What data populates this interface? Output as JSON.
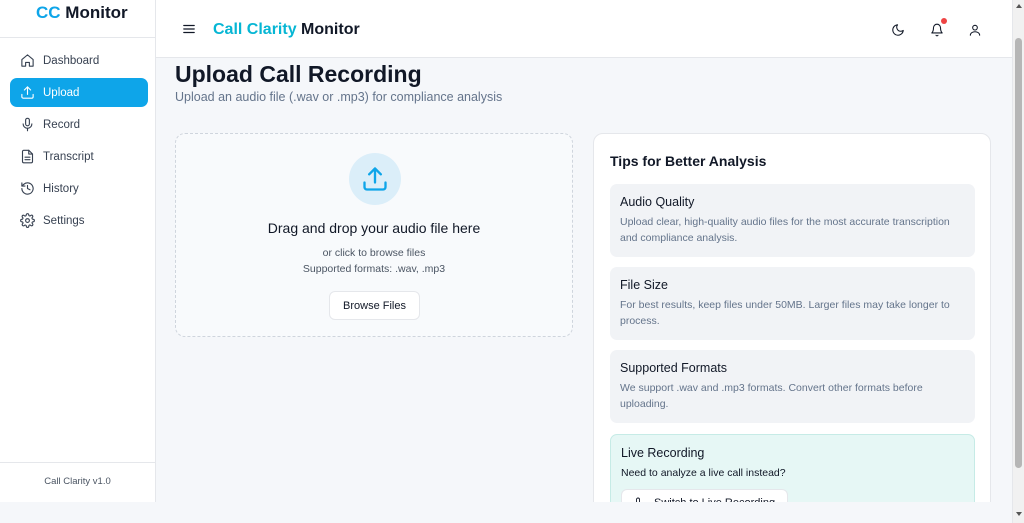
{
  "sidebar": {
    "brand_accent": "CC",
    "brand_rest": " Monitor",
    "items": [
      {
        "label": "Dashboard",
        "icon": "home-icon"
      },
      {
        "label": "Upload",
        "icon": "upload-icon",
        "active": true
      },
      {
        "label": "Record",
        "icon": "microphone-icon"
      },
      {
        "label": "Transcript",
        "icon": "file-text-icon"
      },
      {
        "label": "History",
        "icon": "history-icon"
      },
      {
        "label": "Settings",
        "icon": "gear-icon"
      }
    ],
    "footer": "Call Clarity v1.0"
  },
  "header": {
    "title_accent": "Call Clarity",
    "title_rest": " Monitor",
    "icons": [
      "menu-icon",
      "moon-icon",
      "bell-icon",
      "user-icon"
    ]
  },
  "page": {
    "title": "Upload Call Recording",
    "subtitle": "Upload an audio file (.wav or .mp3) for compliance analysis"
  },
  "dropzone": {
    "title": "Drag and drop your audio file here",
    "hint": "or click to browse files",
    "formats": "Supported formats: .wav, .mp3",
    "button": "Browse Files"
  },
  "tips": {
    "title": "Tips for Better Analysis",
    "items": [
      {
        "title": "Audio Quality",
        "text": "Upload clear, high-quality audio files for the most accurate transcription and compliance analysis."
      },
      {
        "title": "File Size",
        "text": "For best results, keep files under 50MB. Larger files may take longer to process."
      },
      {
        "title": "Supported Formats",
        "text": "We support .wav and .mp3 formats. Convert other formats before uploading."
      }
    ],
    "live": {
      "title": "Live Recording",
      "text": "Need to analyze a live call instead?",
      "button": "Switch to Live Recording"
    }
  },
  "colors": {
    "accent": "#0ea5e9",
    "title_accent": "#06b6d4",
    "notification": "#ef4444"
  }
}
